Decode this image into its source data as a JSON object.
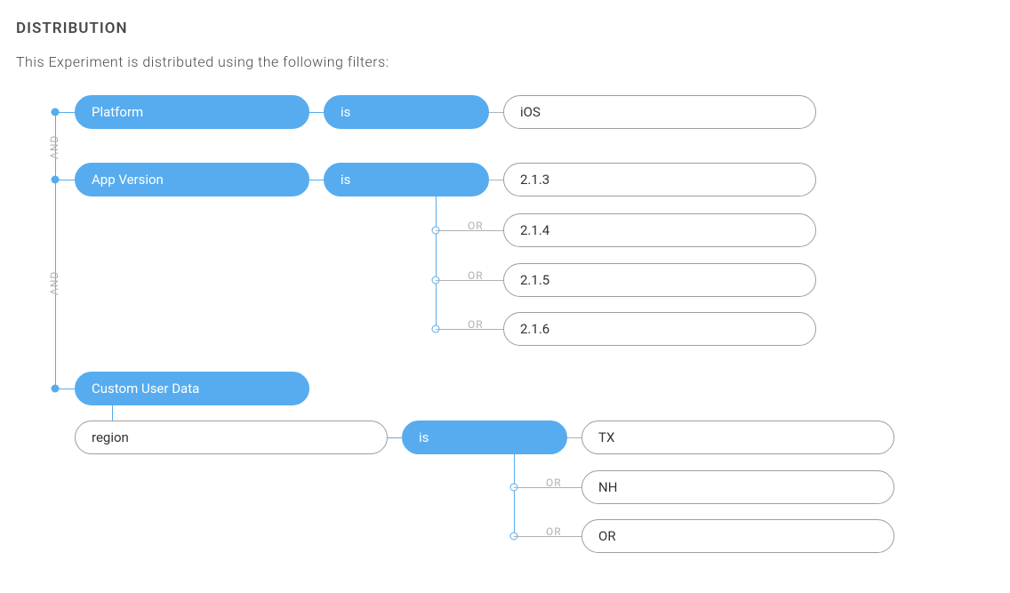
{
  "section_title": "DISTRIBUTION",
  "subtitle": "This Experiment is distributed using the following filters:",
  "connectors": {
    "and": "AND",
    "or": "OR"
  },
  "filters": [
    {
      "field": "Platform",
      "operator": "is",
      "values": [
        "iOS"
      ]
    },
    {
      "field": "App Version",
      "operator": "is",
      "values": [
        "2.1.3",
        "2.1.4",
        "2.1.5",
        "2.1.6"
      ]
    },
    {
      "field": "Custom User Data",
      "key": "region",
      "operator": "is",
      "values": [
        "TX",
        "NH",
        "OR"
      ]
    }
  ]
}
